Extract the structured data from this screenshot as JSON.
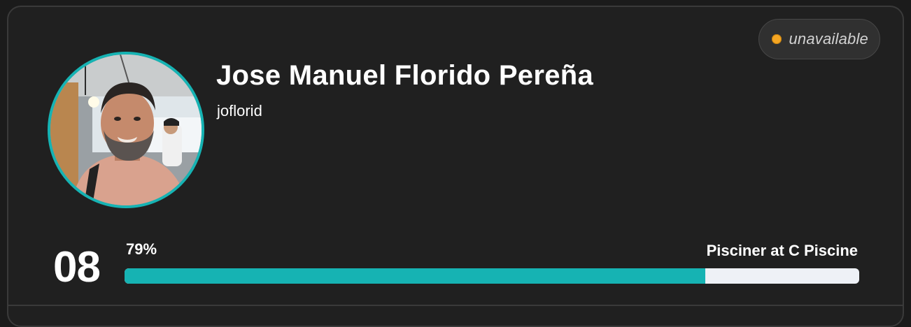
{
  "profile": {
    "full_name": "Jose Manuel Florido Pereña",
    "login": "joflorid",
    "status": "unavailable"
  },
  "progress": {
    "level": "08",
    "percent_label": "79%",
    "percent_value": 0.79,
    "role": "Pisciner at C Piscine"
  },
  "colors": {
    "accent": "#16b3b3",
    "status_dot": "#f5a623",
    "card_bg": "#202020",
    "track": "#eef1f6"
  },
  "icons": {
    "status": "status-dot-icon",
    "avatar": "user-avatar-photo"
  }
}
